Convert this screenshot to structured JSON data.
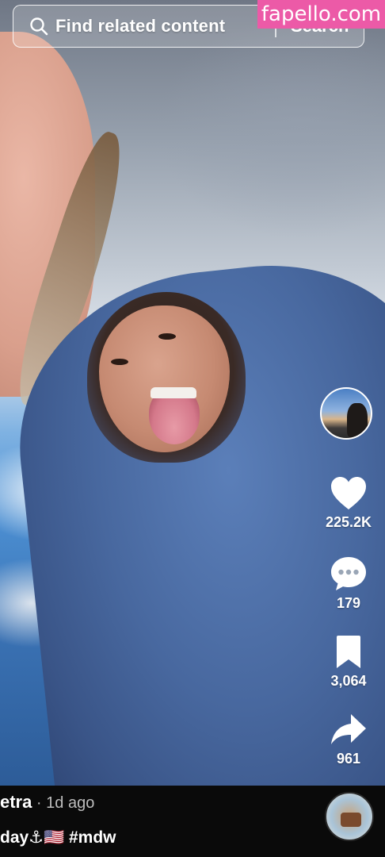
{
  "search": {
    "placeholder": "Find related content",
    "button_label": "Search"
  },
  "watermark": "fapello.com",
  "actions": {
    "likes": "225.2K",
    "comments": "179",
    "saves": "3,064",
    "shares": "961"
  },
  "post": {
    "author": "etra",
    "separator": " · ",
    "time": "1d ago",
    "caption": "day⚓🇺🇸 #mdw"
  },
  "icons": {
    "search": "search-icon",
    "like": "heart-icon",
    "comment": "comment-icon",
    "save": "bookmark-icon",
    "share": "share-arrow-icon"
  },
  "colors": {
    "watermark_bg": "#ec5aa7",
    "text": "#ffffff"
  }
}
